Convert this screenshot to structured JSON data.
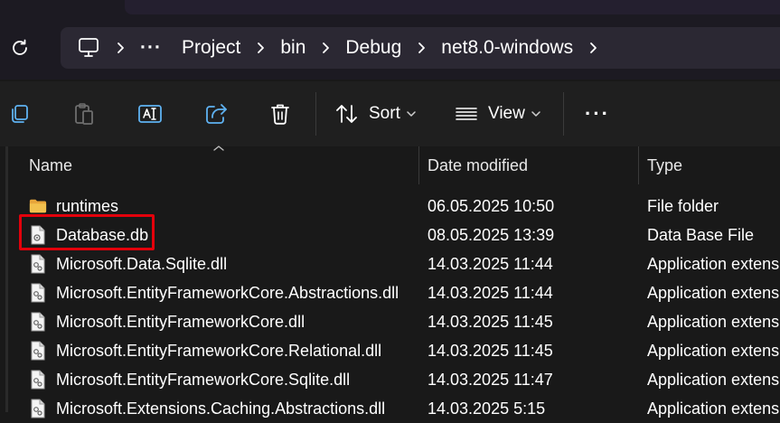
{
  "address_bar": {
    "breadcrumbs": [
      "Project",
      "bin",
      "Debug",
      "net8.0-windows"
    ],
    "overflow_glyph": "···"
  },
  "toolbar": {
    "sort_label": "Sort",
    "view_label": "View",
    "more_glyph": "···",
    "icons": [
      "copy-icon",
      "paste-icon",
      "rename-icon",
      "share-icon",
      "delete-icon",
      "sort-icon",
      "view-icon",
      "more-icon"
    ]
  },
  "columns": {
    "name": "Name",
    "date": "Date modified",
    "type": "Type"
  },
  "files": [
    {
      "name": "runtimes",
      "date": "06.05.2025 10:50",
      "type": "File folder",
      "icon": "folder-icon"
    },
    {
      "name": "Database.db",
      "date": "08.05.2025 13:39",
      "type": "Data Base File",
      "icon": "file-icon",
      "highlighted": true
    },
    {
      "name": "Microsoft.Data.Sqlite.dll",
      "date": "14.03.2025 11:44",
      "type": "Application extensi",
      "icon": "dll-file-icon"
    },
    {
      "name": "Microsoft.EntityFrameworkCore.Abstractions.dll",
      "date": "14.03.2025 11:44",
      "type": "Application extensi",
      "icon": "dll-file-icon"
    },
    {
      "name": "Microsoft.EntityFrameworkCore.dll",
      "date": "14.03.2025 11:45",
      "type": "Application extensi",
      "icon": "dll-file-icon"
    },
    {
      "name": "Microsoft.EntityFrameworkCore.Relational.dll",
      "date": "14.03.2025 11:45",
      "type": "Application extensi",
      "icon": "dll-file-icon"
    },
    {
      "name": "Microsoft.EntityFrameworkCore.Sqlite.dll",
      "date": "14.03.2025 11:47",
      "type": "Application extensi",
      "icon": "dll-file-icon"
    },
    {
      "name": "Microsoft.Extensions.Caching.Abstractions.dll",
      "date": "14.03.2025 5:15",
      "type": "Application extensi",
      "icon": "dll-file-icon"
    }
  ],
  "colors": {
    "highlight": "#e3000b",
    "folder": "#f2c14e"
  }
}
